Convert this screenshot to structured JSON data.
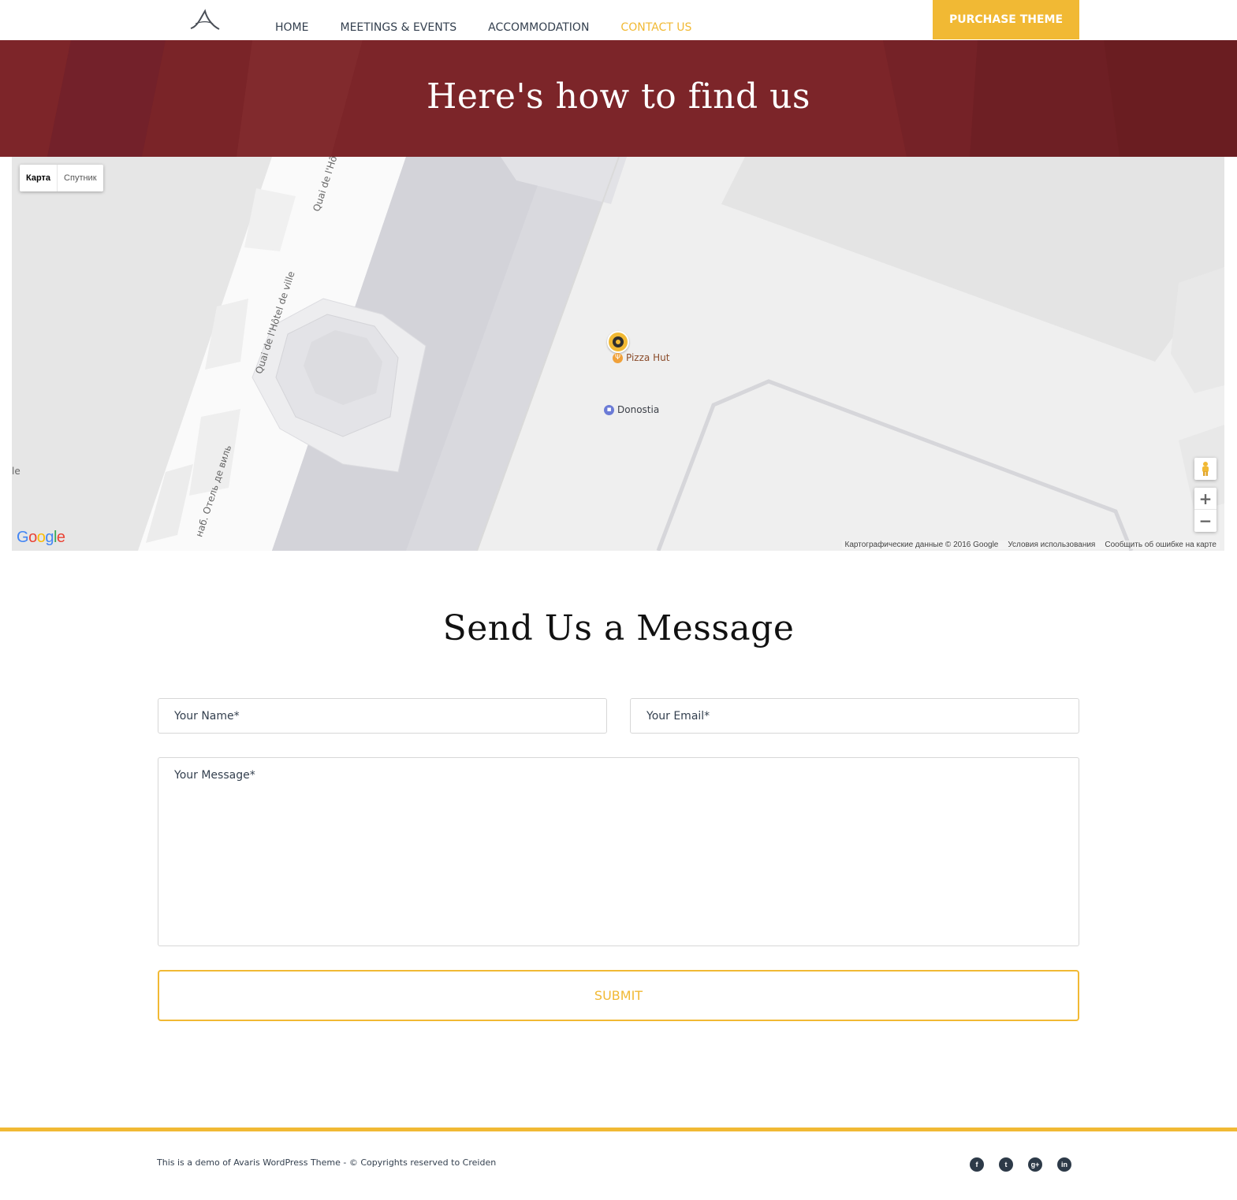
{
  "header": {
    "nav": [
      "HOME",
      "MEETINGS & EVENTS",
      "ACCOMMODATION",
      "CONTACT US"
    ],
    "active_nav": "CONTACT US",
    "purchase_label": "PURCHASE THEME"
  },
  "hero": {
    "title": "Here's how to find us"
  },
  "map": {
    "type_map": "Карта",
    "type_satellite": "Спутник",
    "roads": [
      "Quai de l'Hô",
      "Quai de l'Hôtel de ville",
      "наб. Отель де виль"
    ],
    "edge_label": "le",
    "pois": [
      {
        "name": "Pizza Hut",
        "icon": "restaurant-icon"
      },
      {
        "name": "Donostia",
        "icon": "shopping-bag-icon"
      }
    ],
    "zoom_in": "+",
    "zoom_out": "−",
    "google_logo": "Google",
    "attribution": {
      "data": "Картографические данные © 2016 Google",
      "terms": "Условия использования",
      "report": "Сообщить об ошибке на карте"
    }
  },
  "form": {
    "title": "Send Us a Message",
    "name_placeholder": "Your Name*",
    "email_placeholder": "Your Email*",
    "message_placeholder": "Your Message*",
    "submit_label": "SUBMIT"
  },
  "footer": {
    "text": "This is a demo of Avaris WordPress Theme - © Copyrights reserved to Creiden",
    "socials": [
      {
        "name": "facebook-icon",
        "glyph": "f"
      },
      {
        "name": "twitter-icon",
        "glyph": "t"
      },
      {
        "name": "google-plus-icon",
        "glyph": "g+"
      },
      {
        "name": "linkedin-icon",
        "glyph": "in"
      }
    ]
  },
  "colors": {
    "accent": "#f1b934",
    "hero_bg": "#772327",
    "text": "#34404f"
  }
}
